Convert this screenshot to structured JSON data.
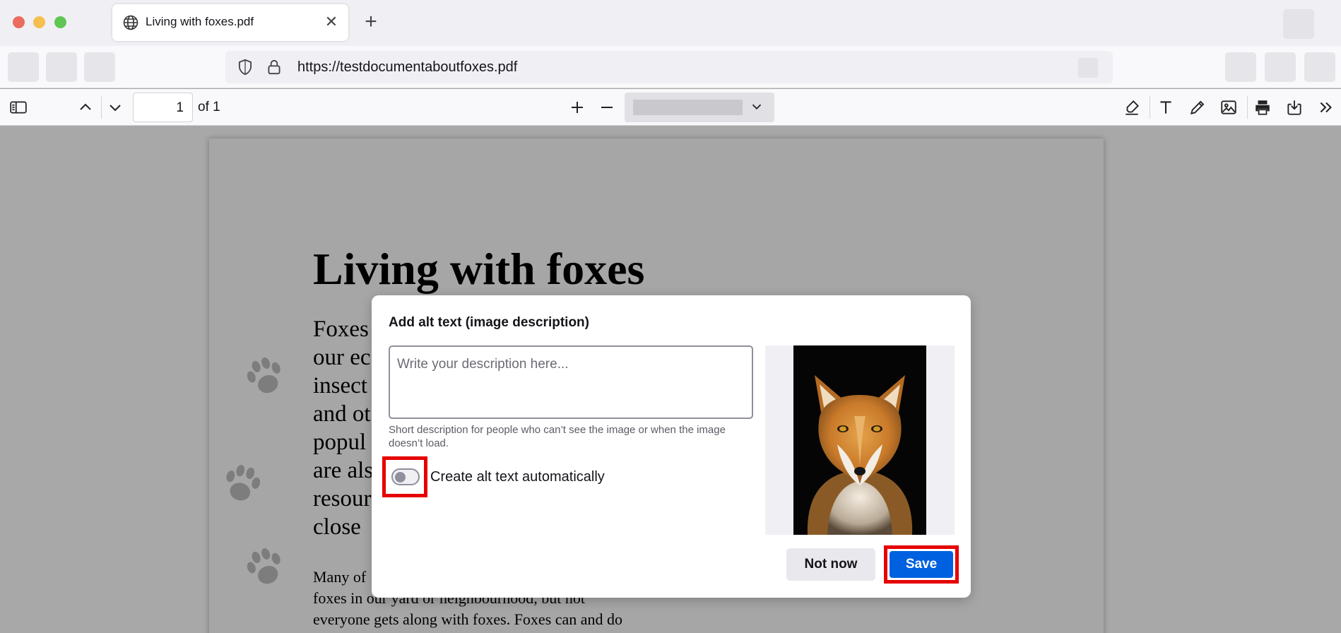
{
  "browser": {
    "tab": {
      "title": "Living with foxes.pdf",
      "close_icon": "✕",
      "globe_icon": "globe-icon"
    },
    "new_tab_icon": "+",
    "url": "https://testdocumentaboutfoxes.pdf"
  },
  "pdf_toolbar": {
    "page_number": "1",
    "page_count_label": "of 1",
    "zoom_in_icon": "+",
    "zoom_out_icon": "−"
  },
  "document": {
    "title": "Living with foxes",
    "para1_lines": [
      "Foxes",
      "our ec",
      "insect",
      "and ot",
      "popul",
      "are als",
      "resour",
      "close"
    ],
    "para2_lines": [
      "Many of",
      "foxes in our yard or neighbourhood, but not",
      "everyone gets along with foxes. Foxes can and do"
    ]
  },
  "dialog": {
    "title": "Add alt text (image description)",
    "textarea_placeholder": "Write your description here...",
    "textarea_value": "",
    "help_text": "Short description for people who can’t see the image or when the image doesn’t load.",
    "toggle_label": "Create alt text automatically",
    "toggle_on": false,
    "not_now_label": "Not now",
    "save_label": "Save"
  },
  "colors": {
    "accent": "#0061e0",
    "highlight": "#e60000",
    "traffic_close": "#ec6a5e",
    "traffic_min": "#f4bf4f",
    "traffic_max": "#61c554"
  }
}
